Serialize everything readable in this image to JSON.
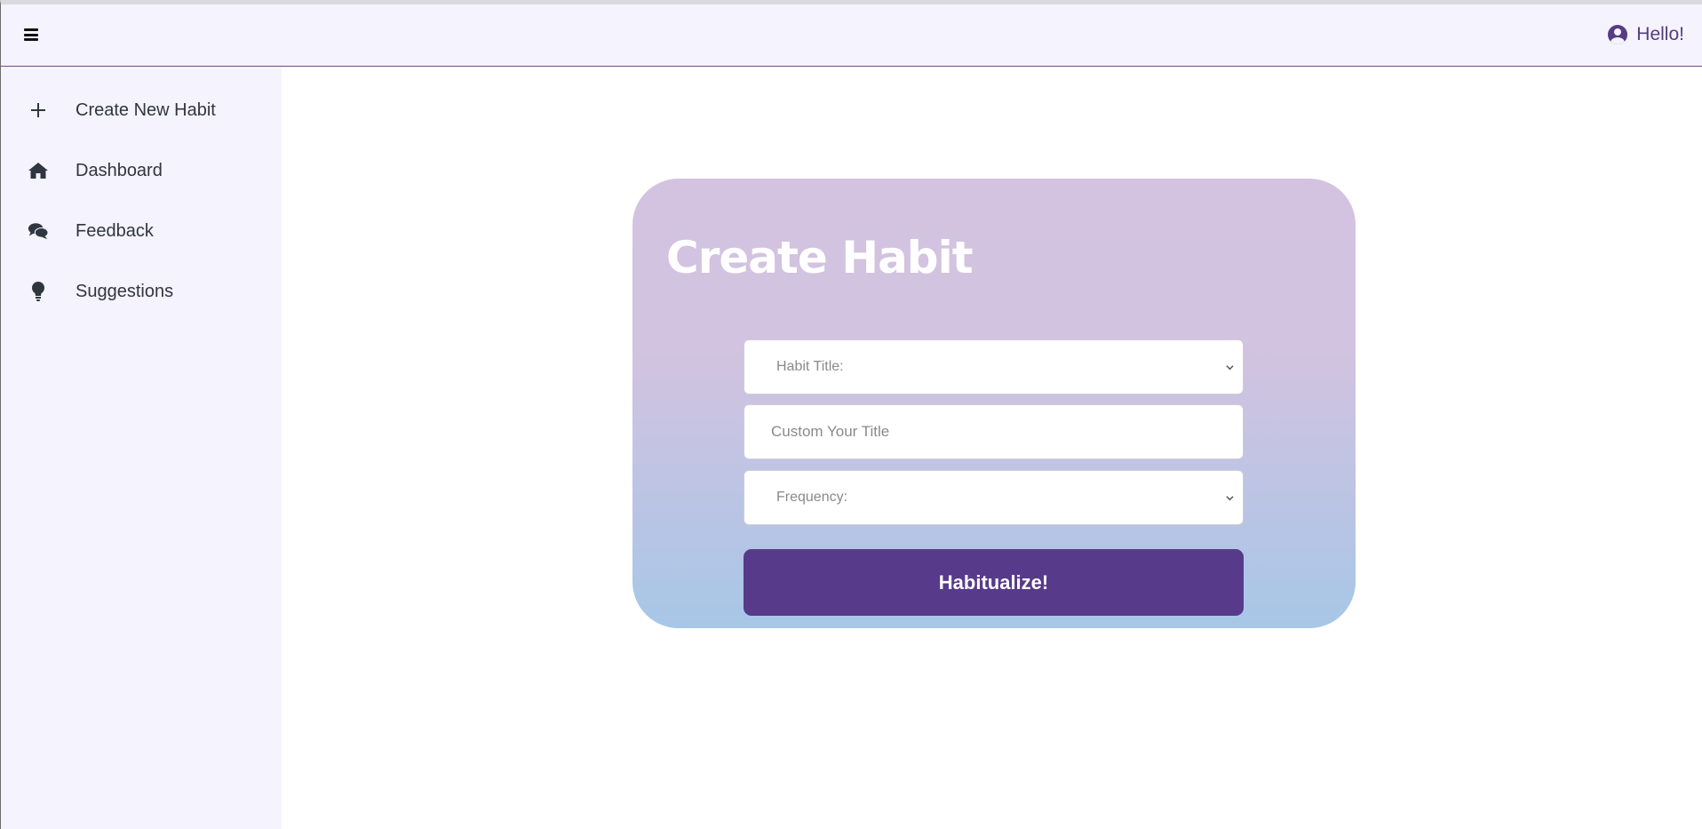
{
  "header": {
    "greeting": "Hello!",
    "menu_icon": "hamburger-icon",
    "user_icon": "user-circle-icon"
  },
  "sidebar": {
    "items": [
      {
        "label": "Create New Habit",
        "icon": "plus-icon"
      },
      {
        "label": "Dashboard",
        "icon": "home-icon"
      },
      {
        "label": "Feedback",
        "icon": "comments-icon"
      },
      {
        "label": "Suggestions",
        "icon": "lightbulb-icon"
      }
    ]
  },
  "form": {
    "title": "Create Habit",
    "habit_title_select": "Habit Title:",
    "custom_title_placeholder": "Custom Your Title",
    "frequency_select": "Frequency:",
    "submit_label": "Habitualize!"
  },
  "colors": {
    "accent": "#573a8a",
    "sidebar_bg": "#f5f3fd",
    "card_top": "#d3c3e0",
    "card_bottom": "#a7c7e7"
  }
}
